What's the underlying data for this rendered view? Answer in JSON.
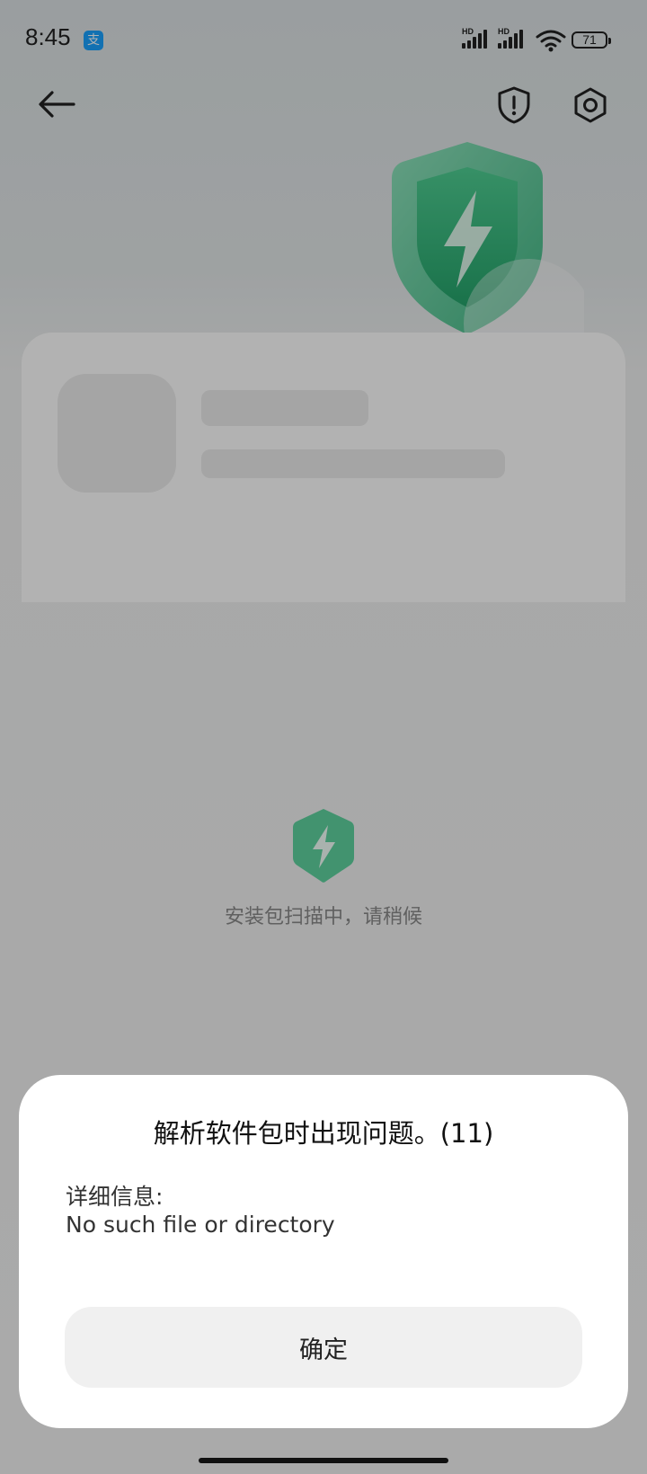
{
  "status_bar": {
    "time": "8:45",
    "notification_app": "支",
    "signal_1_label": "HD",
    "signal_2_label": "HD",
    "battery_level": "71"
  },
  "top_bar": {
    "back_icon": "arrow-left-icon",
    "security_icon": "shield-exclamation-icon",
    "settings_icon": "hexagon-settings-icon"
  },
  "scan": {
    "status_text": "安装包扫描中，请稍候"
  },
  "dialog": {
    "title": "解析软件包时出现问题。(11)",
    "details_label": "详细信息:",
    "details_message": "No such file or directory",
    "confirm_label": "确定"
  },
  "colors": {
    "accent_green": "#3ec08a",
    "dialog_bg": "#ffffff",
    "button_bg": "#f0f0f0"
  }
}
